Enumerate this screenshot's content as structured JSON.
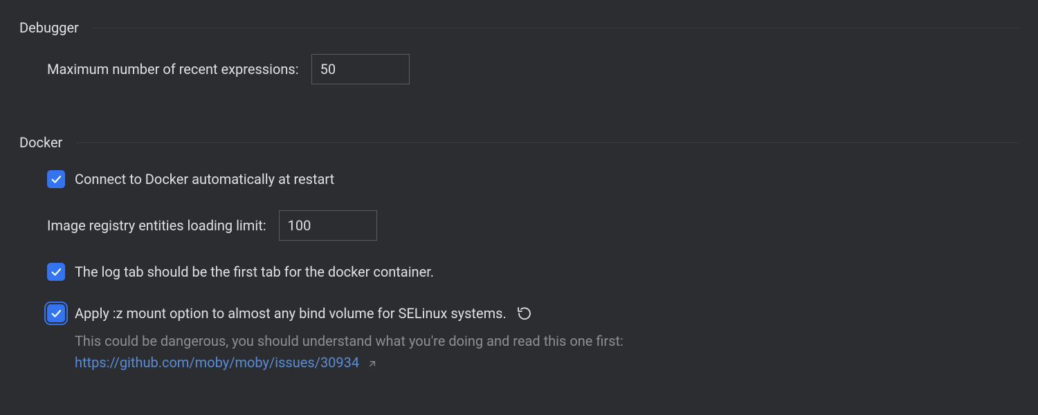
{
  "debugger": {
    "title": "Debugger",
    "max_recent_expressions_label": "Maximum number of recent expressions:",
    "max_recent_expressions_value": "50"
  },
  "docker": {
    "title": "Docker",
    "connect_automatically_label": "Connect to Docker automatically at restart",
    "connect_automatically_checked": true,
    "image_registry_limit_label": "Image registry entities loading limit:",
    "image_registry_limit_value": "100",
    "log_tab_first_label": "The log tab should be the first tab for the docker container.",
    "log_tab_first_checked": true,
    "apply_z_mount_label": "Apply :z mount option to almost any bind volume for SELinux systems.",
    "apply_z_mount_checked": true,
    "apply_z_mount_help": "This could be dangerous, you should understand what you're doing and read this one first:",
    "apply_z_mount_link": "https://github.com/moby/moby/issues/30934"
  }
}
